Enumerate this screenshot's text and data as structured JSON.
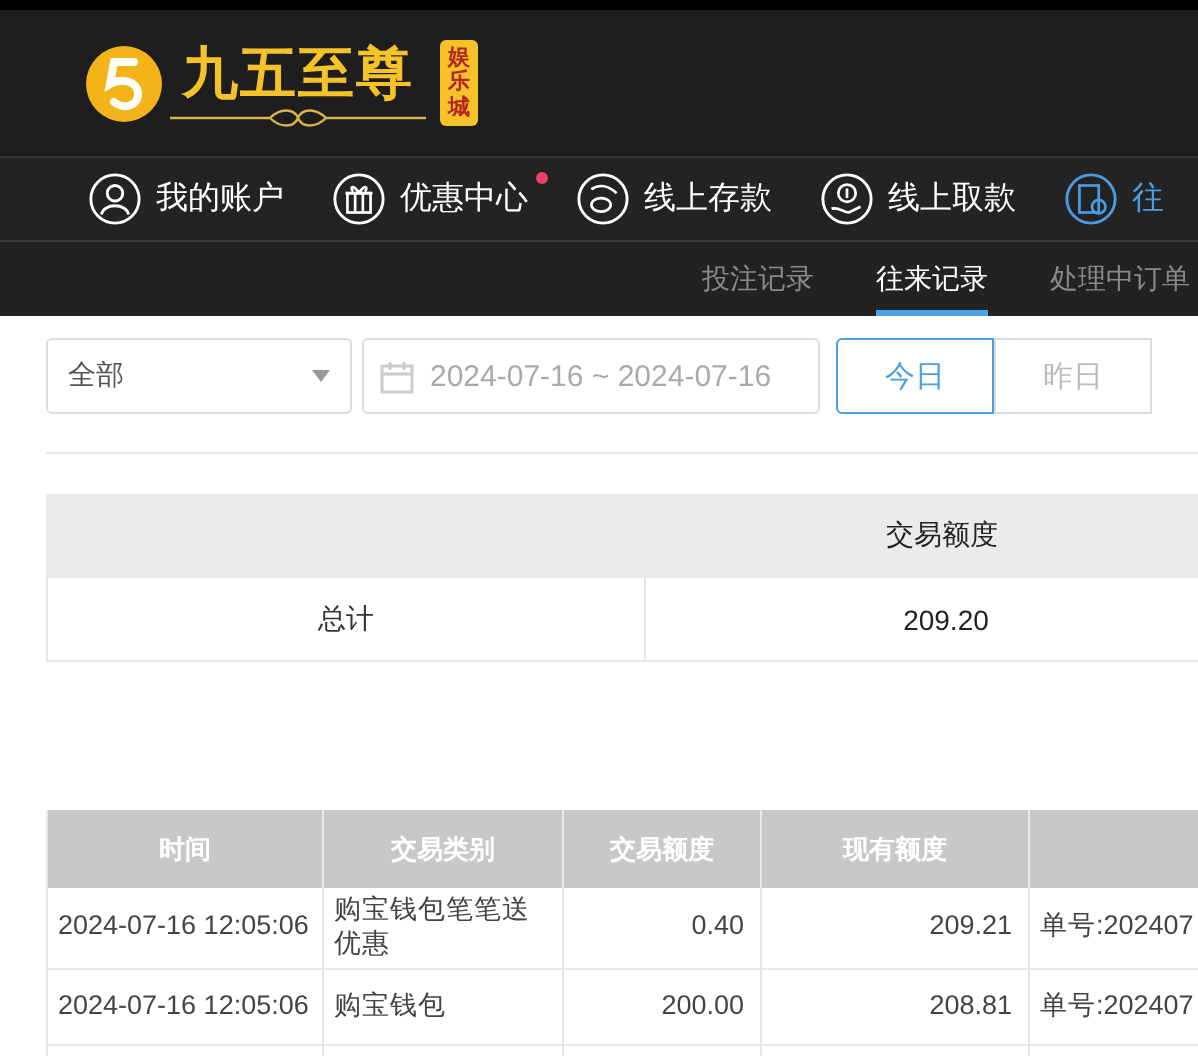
{
  "logo": {
    "title": "九五至尊",
    "badge": "娱乐城"
  },
  "nav": [
    {
      "label": "我的账户",
      "selected": false,
      "dot": false
    },
    {
      "label": "优惠中心",
      "selected": false,
      "dot": true
    },
    {
      "label": "线上存款",
      "selected": false,
      "dot": false
    },
    {
      "label": "线上取款",
      "selected": false,
      "dot": false
    },
    {
      "label": "往",
      "selected": true,
      "dot": false
    }
  ],
  "subtabs": [
    {
      "label": "投注记录",
      "selected": false
    },
    {
      "label": "往来记录",
      "selected": true
    },
    {
      "label": "处理中订单",
      "selected": false
    }
  ],
  "filters": {
    "type_select": {
      "value": "全部"
    },
    "date_range": {
      "value": "2024-07-16 ~ 2024-07-16"
    },
    "quick_dates": [
      {
        "label": "今日",
        "selected": true
      },
      {
        "label": "昨日",
        "selected": false
      }
    ]
  },
  "summary": {
    "columns": [
      "交易额度"
    ],
    "rows": [
      {
        "label": "总计",
        "values": [
          "209.20"
        ]
      }
    ]
  },
  "table": {
    "columns": [
      "时间",
      "交易类别",
      "交易额度",
      "现有额度"
    ],
    "rows": [
      {
        "cells": [
          "2024-07-16 12:05:06",
          "购宝钱包笔笔送优惠",
          "0.40",
          "209.21",
          "单号:202407"
        ]
      },
      {
        "cells": [
          "2024-07-16 12:05:06",
          "购宝钱包",
          "200.00",
          "208.81",
          "单号:202407"
        ]
      }
    ]
  }
}
